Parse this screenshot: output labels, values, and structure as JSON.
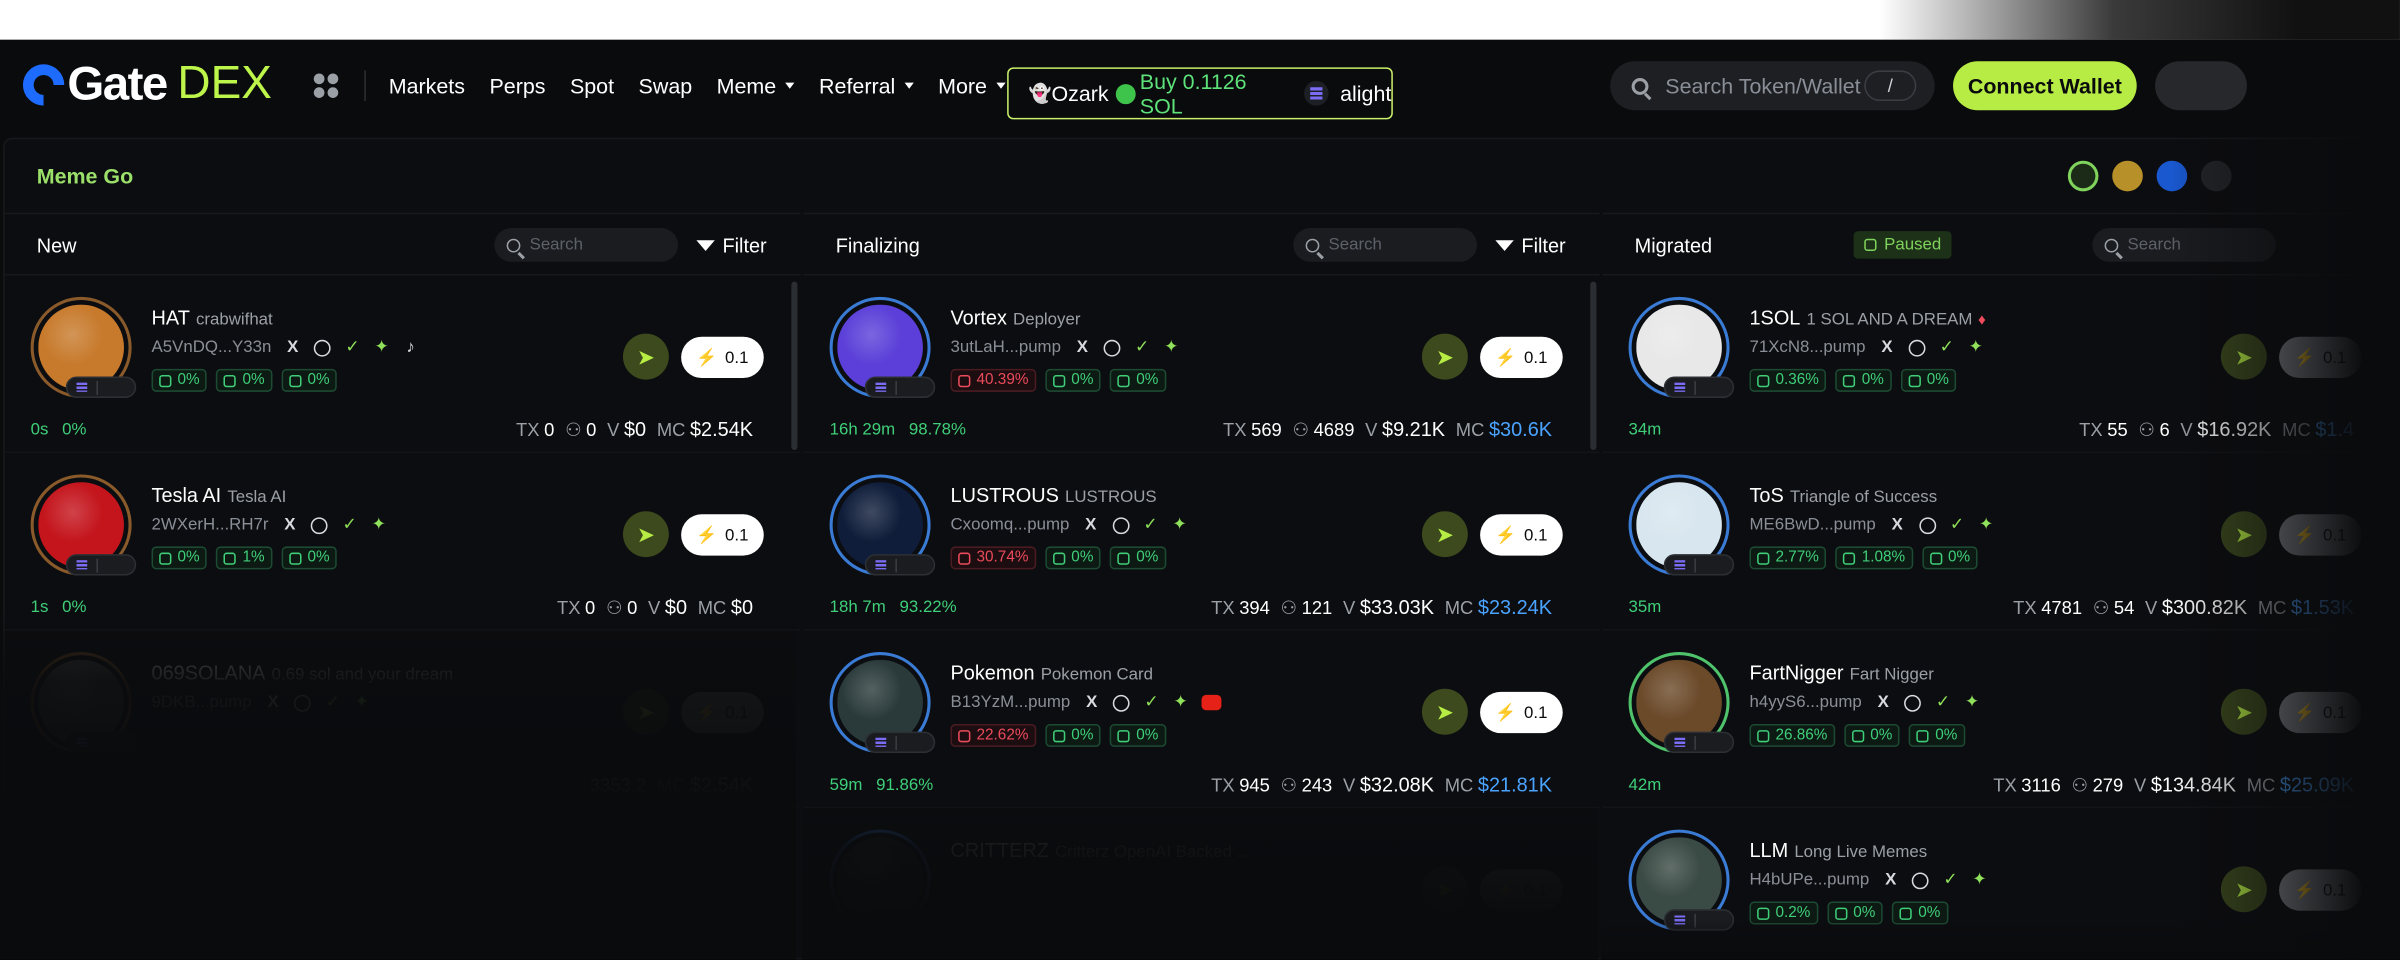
{
  "nav": {
    "logo": "Gate",
    "logo_dex": "DEX",
    "menu": [
      {
        "label": "Markets"
      },
      {
        "label": "Perps"
      },
      {
        "label": "Spot"
      },
      {
        "label": "Swap"
      },
      {
        "label": "Meme"
      },
      {
        "label": "Referral"
      },
      {
        "label": "More"
      }
    ],
    "ticker": {
      "user": "Ozark",
      "action": "Buy 0.1126 SOL",
      "token": "alight"
    },
    "search_placeholder": "Search Token/Wallet",
    "search_shortcut": "/",
    "connect_label": "Connect Wallet"
  },
  "colors": {
    "accent": "#b6ec43",
    "positive": "#3fcf79",
    "negative": "#ec4b5c",
    "mc_highlight": "#4aa3ff"
  },
  "main": {
    "title": "Meme Go",
    "columns": [
      {
        "name": "New",
        "search_placeholder": "Search",
        "filter_label": "Filter",
        "cards": [
          {
            "symbol": "HAT",
            "name": "crabwifhat",
            "addr": "A5VnDQ...Y33n",
            "p1": "0%",
            "p2": "0%",
            "p3": "0%",
            "age": "0s",
            "pct": "0%",
            "tx": "0",
            "holders": "0",
            "vol": "$0",
            "mc": "$2.54K",
            "btn": "0.1",
            "av": "#c77a2c"
          },
          {
            "symbol": "Tesla AI",
            "name": "Tesla AI",
            "addr": "2WXerH...RH7r",
            "p1": "0%",
            "p2": "1%",
            "p3": "0%",
            "age": "1s",
            "pct": "0%",
            "tx": "0",
            "holders": "0",
            "vol": "$0",
            "mc": "$0",
            "btn": "0.1",
            "av": "#c4141c"
          },
          {
            "symbol": "069SOLANA",
            "name": "0.69 sol and your dream",
            "addr": "9DKB...pump",
            "btn": "0.1",
            "tail": "3353.2",
            "mc": "$2.54K",
            "av": "#555"
          }
        ]
      },
      {
        "name": "Finalizing",
        "search_placeholder": "Search",
        "filter_label": "Filter",
        "cards": [
          {
            "symbol": "Vortex",
            "name": "Deployer",
            "addr": "3utLaH...pump",
            "p1": "40.39%",
            "p2": "0%",
            "p3": "0%",
            "age": "16h 29m",
            "pct": "98.78%",
            "tx": "569",
            "holders": "4689",
            "vol": "$9.21K",
            "mc": "$30.6K",
            "btn": "0.1",
            "av": "#5b3fd8"
          },
          {
            "symbol": "LUSTROUS",
            "name": "LUSTROUS",
            "addr": "Cxoomq...pump",
            "p1": "30.74%",
            "p2": "0%",
            "p3": "0%",
            "age": "18h 7m",
            "pct": "93.22%",
            "tx": "394",
            "holders": "121",
            "vol": "$33.03K",
            "mc": "$23.24K",
            "btn": "0.1",
            "av": "#0f1d3a"
          },
          {
            "symbol": "Pokemon",
            "name": "Pokemon Card",
            "addr": "B13YzM...pump",
            "p1": "22.62%",
            "p2": "0%",
            "p3": "0%",
            "age": "59m",
            "pct": "91.86%",
            "tx": "945",
            "holders": "243",
            "vol": "$32.08K",
            "mc": "$21.81K",
            "btn": "0.1",
            "av": "#2a3a3a"
          },
          {
            "symbol": "CRITTERZ",
            "name": "Critterz OpenAI Backed ...",
            "btn": "0.1",
            "av": "#333"
          }
        ]
      },
      {
        "name": "Migrated",
        "paused_label": "Paused",
        "search_placeholder": "Search",
        "cards": [
          {
            "symbol": "1SOL",
            "name": "1 SOL AND A DREAM",
            "addr": "71XcN8...pump",
            "p1": "0.36%",
            "p2": "0%",
            "p3": "0%",
            "age": "34m",
            "tx": "55",
            "holders": "6",
            "vol": "$16.92K",
            "mc": "$1.4",
            "btn": "0.1",
            "av": "#e8e8e8"
          },
          {
            "symbol": "ToS",
            "name": "Triangle of Success",
            "addr": "ME6BwD...pump",
            "p1": "2.77%",
            "p2": "1.08%",
            "p3": "0%",
            "age": "35m",
            "tx": "4781",
            "holders": "54",
            "vol": "$300.82K",
            "mc": "$1.53K",
            "btn": "0.1",
            "av": "#d8e6ef"
          },
          {
            "symbol": "FartNigger",
            "name": "Fart Nigger",
            "addr": "h4yyS6...pump",
            "p1": "26.86%",
            "p2": "0%",
            "p3": "0%",
            "age": "42m",
            "tx": "3116",
            "holders": "279",
            "vol": "$134.84K",
            "mc": "$25.09K",
            "btn": "0.1",
            "av": "#6b4a2a"
          },
          {
            "symbol": "LLM",
            "name": "Long Live Memes",
            "addr": "H4bUPe...pump",
            "p1": "0.2%",
            "p2": "0%",
            "p3": "0%",
            "btn": "0.1",
            "av": "#3a4a44"
          }
        ]
      }
    ]
  }
}
